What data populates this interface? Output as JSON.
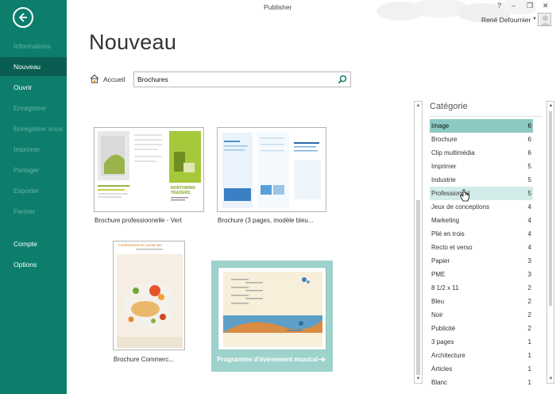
{
  "app": {
    "title": "Publisher"
  },
  "window_buttons": {
    "help": "?",
    "minimize": "–",
    "restore": "❐",
    "close": "✕"
  },
  "user": {
    "name": "René Defournier"
  },
  "sidebar": {
    "items": [
      {
        "label": "Informations",
        "state": "disabled"
      },
      {
        "label": "Nouveau",
        "state": "active"
      },
      {
        "label": "Ouvrir",
        "state": "normal"
      },
      {
        "label": "Enregistrer",
        "state": "disabled"
      },
      {
        "label": "Enregistrer sous",
        "state": "disabled"
      },
      {
        "label": "Imprimer",
        "state": "disabled"
      },
      {
        "label": "Partager",
        "state": "disabled"
      },
      {
        "label": "Exporter",
        "state": "disabled"
      },
      {
        "label": "Fermer",
        "state": "disabled"
      },
      {
        "label": "Compte",
        "state": "normal"
      },
      {
        "label": "Options",
        "state": "normal"
      }
    ]
  },
  "main": {
    "heading": "Nouveau",
    "breadcrumb_home": "Accueil",
    "search": {
      "value": "Brochures"
    }
  },
  "templates": [
    {
      "label": "Brochure professionnelle - Vert"
    },
    {
      "label": "Brochure (3 pages, modèle bleu..."
    },
    {
      "label": "Brochure Commerc..."
    },
    {
      "label": "Programme d'événement musical"
    }
  ],
  "template_thumb_text": {
    "green_company": "NORTHWIND\nTRADERS",
    "food_header": "FOURNISSEUR DE CUISINE BIO"
  },
  "categories": {
    "title": "Catégorie",
    "items": [
      {
        "label": "Image",
        "count": "6",
        "state": "selected"
      },
      {
        "label": "Brochure",
        "count": "6",
        "state": "normal"
      },
      {
        "label": "Clip multimédia",
        "count": "6",
        "state": "normal"
      },
      {
        "label": "Imprimer",
        "count": "5",
        "state": "normal"
      },
      {
        "label": "Industrie",
        "count": "5",
        "state": "normal"
      },
      {
        "label": "Professionnel",
        "count": "5",
        "state": "hover"
      },
      {
        "label": "Jeux de conceptions",
        "count": "4",
        "state": "normal"
      },
      {
        "label": "Marketing",
        "count": "4",
        "state": "normal"
      },
      {
        "label": "Plié en trois",
        "count": "4",
        "state": "normal"
      },
      {
        "label": "Recto et verso",
        "count": "4",
        "state": "normal"
      },
      {
        "label": "Papier",
        "count": "3",
        "state": "normal"
      },
      {
        "label": "PME",
        "count": "3",
        "state": "normal"
      },
      {
        "label": "8 1/2 x 11",
        "count": "2",
        "state": "normal"
      },
      {
        "label": "Bleu",
        "count": "2",
        "state": "normal"
      },
      {
        "label": "Noir",
        "count": "2",
        "state": "normal"
      },
      {
        "label": "Publicité",
        "count": "2",
        "state": "normal"
      },
      {
        "label": "3 pages",
        "count": "1",
        "state": "normal"
      },
      {
        "label": "Architecture",
        "count": "1",
        "state": "normal"
      },
      {
        "label": "Articles",
        "count": "1",
        "state": "normal"
      },
      {
        "label": "Blanc",
        "count": "1",
        "state": "normal"
      }
    ]
  },
  "colors": {
    "accent": "#0e7e6c",
    "accent_dark": "#0a5e51",
    "selected": "#8cc9c2",
    "hover": "#d3ecea"
  }
}
